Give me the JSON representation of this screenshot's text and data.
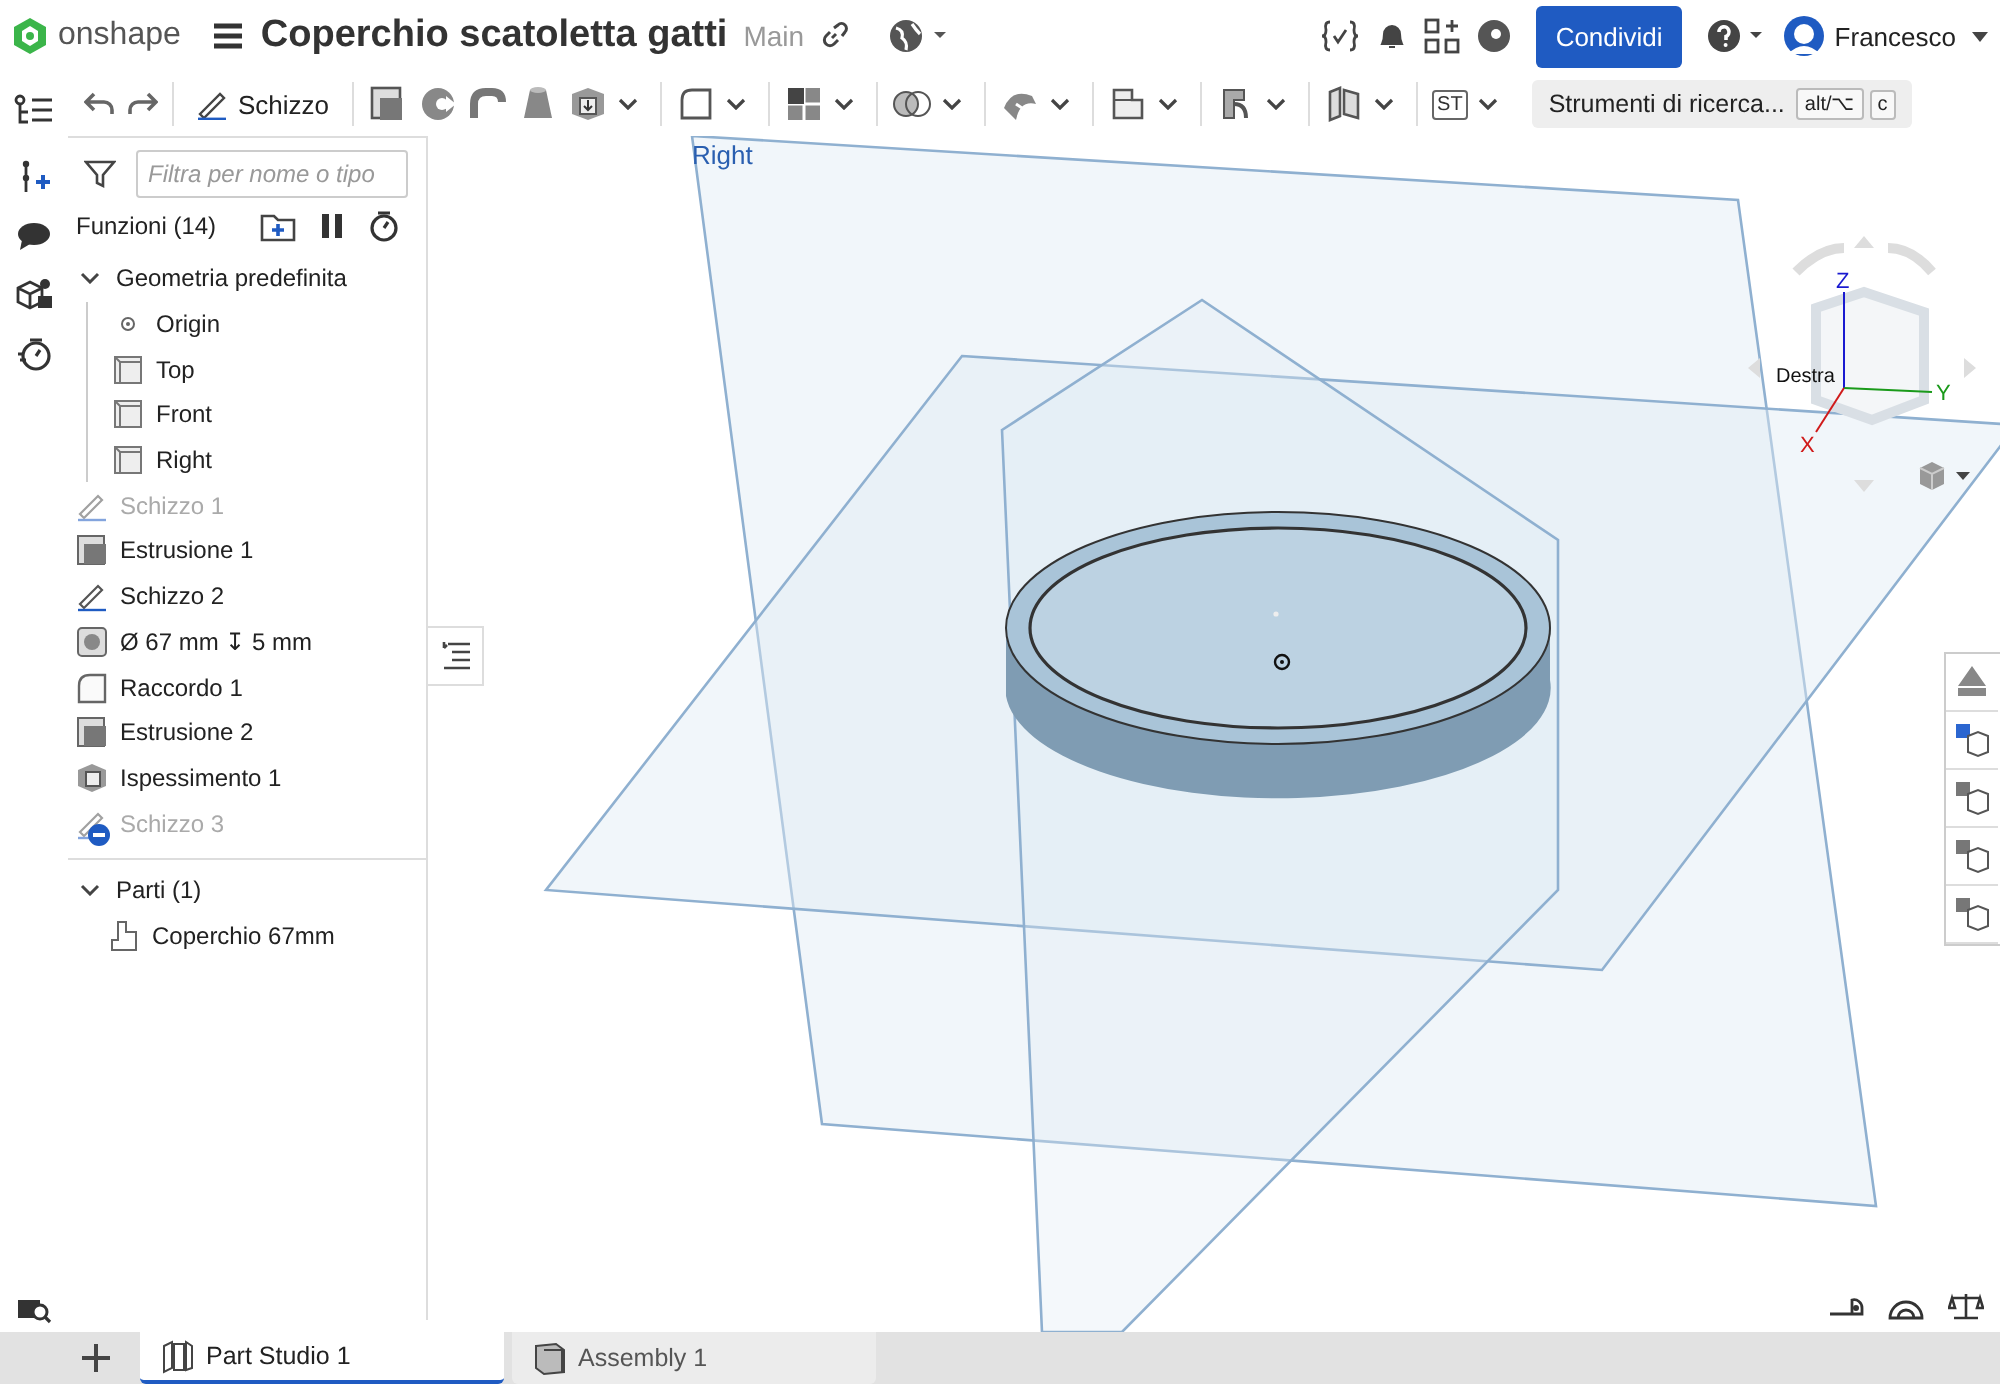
{
  "topbar": {
    "logo": "onshape",
    "title": "Coperchio scatoletta gatti",
    "branch": "Main",
    "share": "Condividi",
    "user": "Francesco"
  },
  "toolbar": {
    "sketch": "Schizzo",
    "st": "ST",
    "search": {
      "label": "Strumenti di ricerca...",
      "keys": [
        "alt/⌥",
        "c"
      ]
    }
  },
  "panel": {
    "filter_placeholder": "Filtra per nome o tipo",
    "header": "Funzioni (14)",
    "default_geometry": {
      "label": "Geometria predefinita",
      "expanded": true,
      "children": [
        {
          "label": "Origin",
          "kind": "origin"
        },
        {
          "label": "Top",
          "kind": "plane"
        },
        {
          "label": "Front",
          "kind": "plane"
        },
        {
          "label": "Right",
          "kind": "plane"
        }
      ]
    },
    "features": [
      {
        "label": "Schizzo 1",
        "kind": "sketch",
        "dimmed": true,
        "badge": false
      },
      {
        "label": "Estrusione 1",
        "kind": "extrude",
        "dimmed": false,
        "badge": false
      },
      {
        "label": "Schizzo 2",
        "kind": "sketch",
        "dimmed": false,
        "badge": false
      },
      {
        "label": "Ø 67 mm ↧ 5 mm",
        "kind": "hole",
        "dimmed": false,
        "badge": false
      },
      {
        "label": "Raccordo 1",
        "kind": "fillet",
        "dimmed": false,
        "badge": false
      },
      {
        "label": "Estrusione 2",
        "kind": "extrude",
        "dimmed": false,
        "badge": false
      },
      {
        "label": "Ispessimento 1",
        "kind": "thicken",
        "dimmed": false,
        "badge": false
      },
      {
        "label": "Schizzo 3",
        "kind": "sketch",
        "dimmed": true,
        "badge": true
      }
    ],
    "parts": {
      "label": "Parti (1)",
      "expanded": true,
      "children": [
        {
          "label": "Coperchio 67mm",
          "kind": "part"
        }
      ]
    }
  },
  "viewport": {
    "plane_label": "Right",
    "view_cube": {
      "face": "Destra",
      "axes": [
        {
          "label": "Z",
          "color": "#1a1ad0"
        },
        {
          "label": "Y",
          "color": "#1a9a1a"
        },
        {
          "label": "X",
          "color": "#d01a1a"
        }
      ]
    }
  },
  "tabs": [
    {
      "label": "Part Studio 1",
      "kind": "partstudio",
      "selected": true
    },
    {
      "label": "Assembly 1",
      "kind": "assembly",
      "selected": false
    }
  ]
}
